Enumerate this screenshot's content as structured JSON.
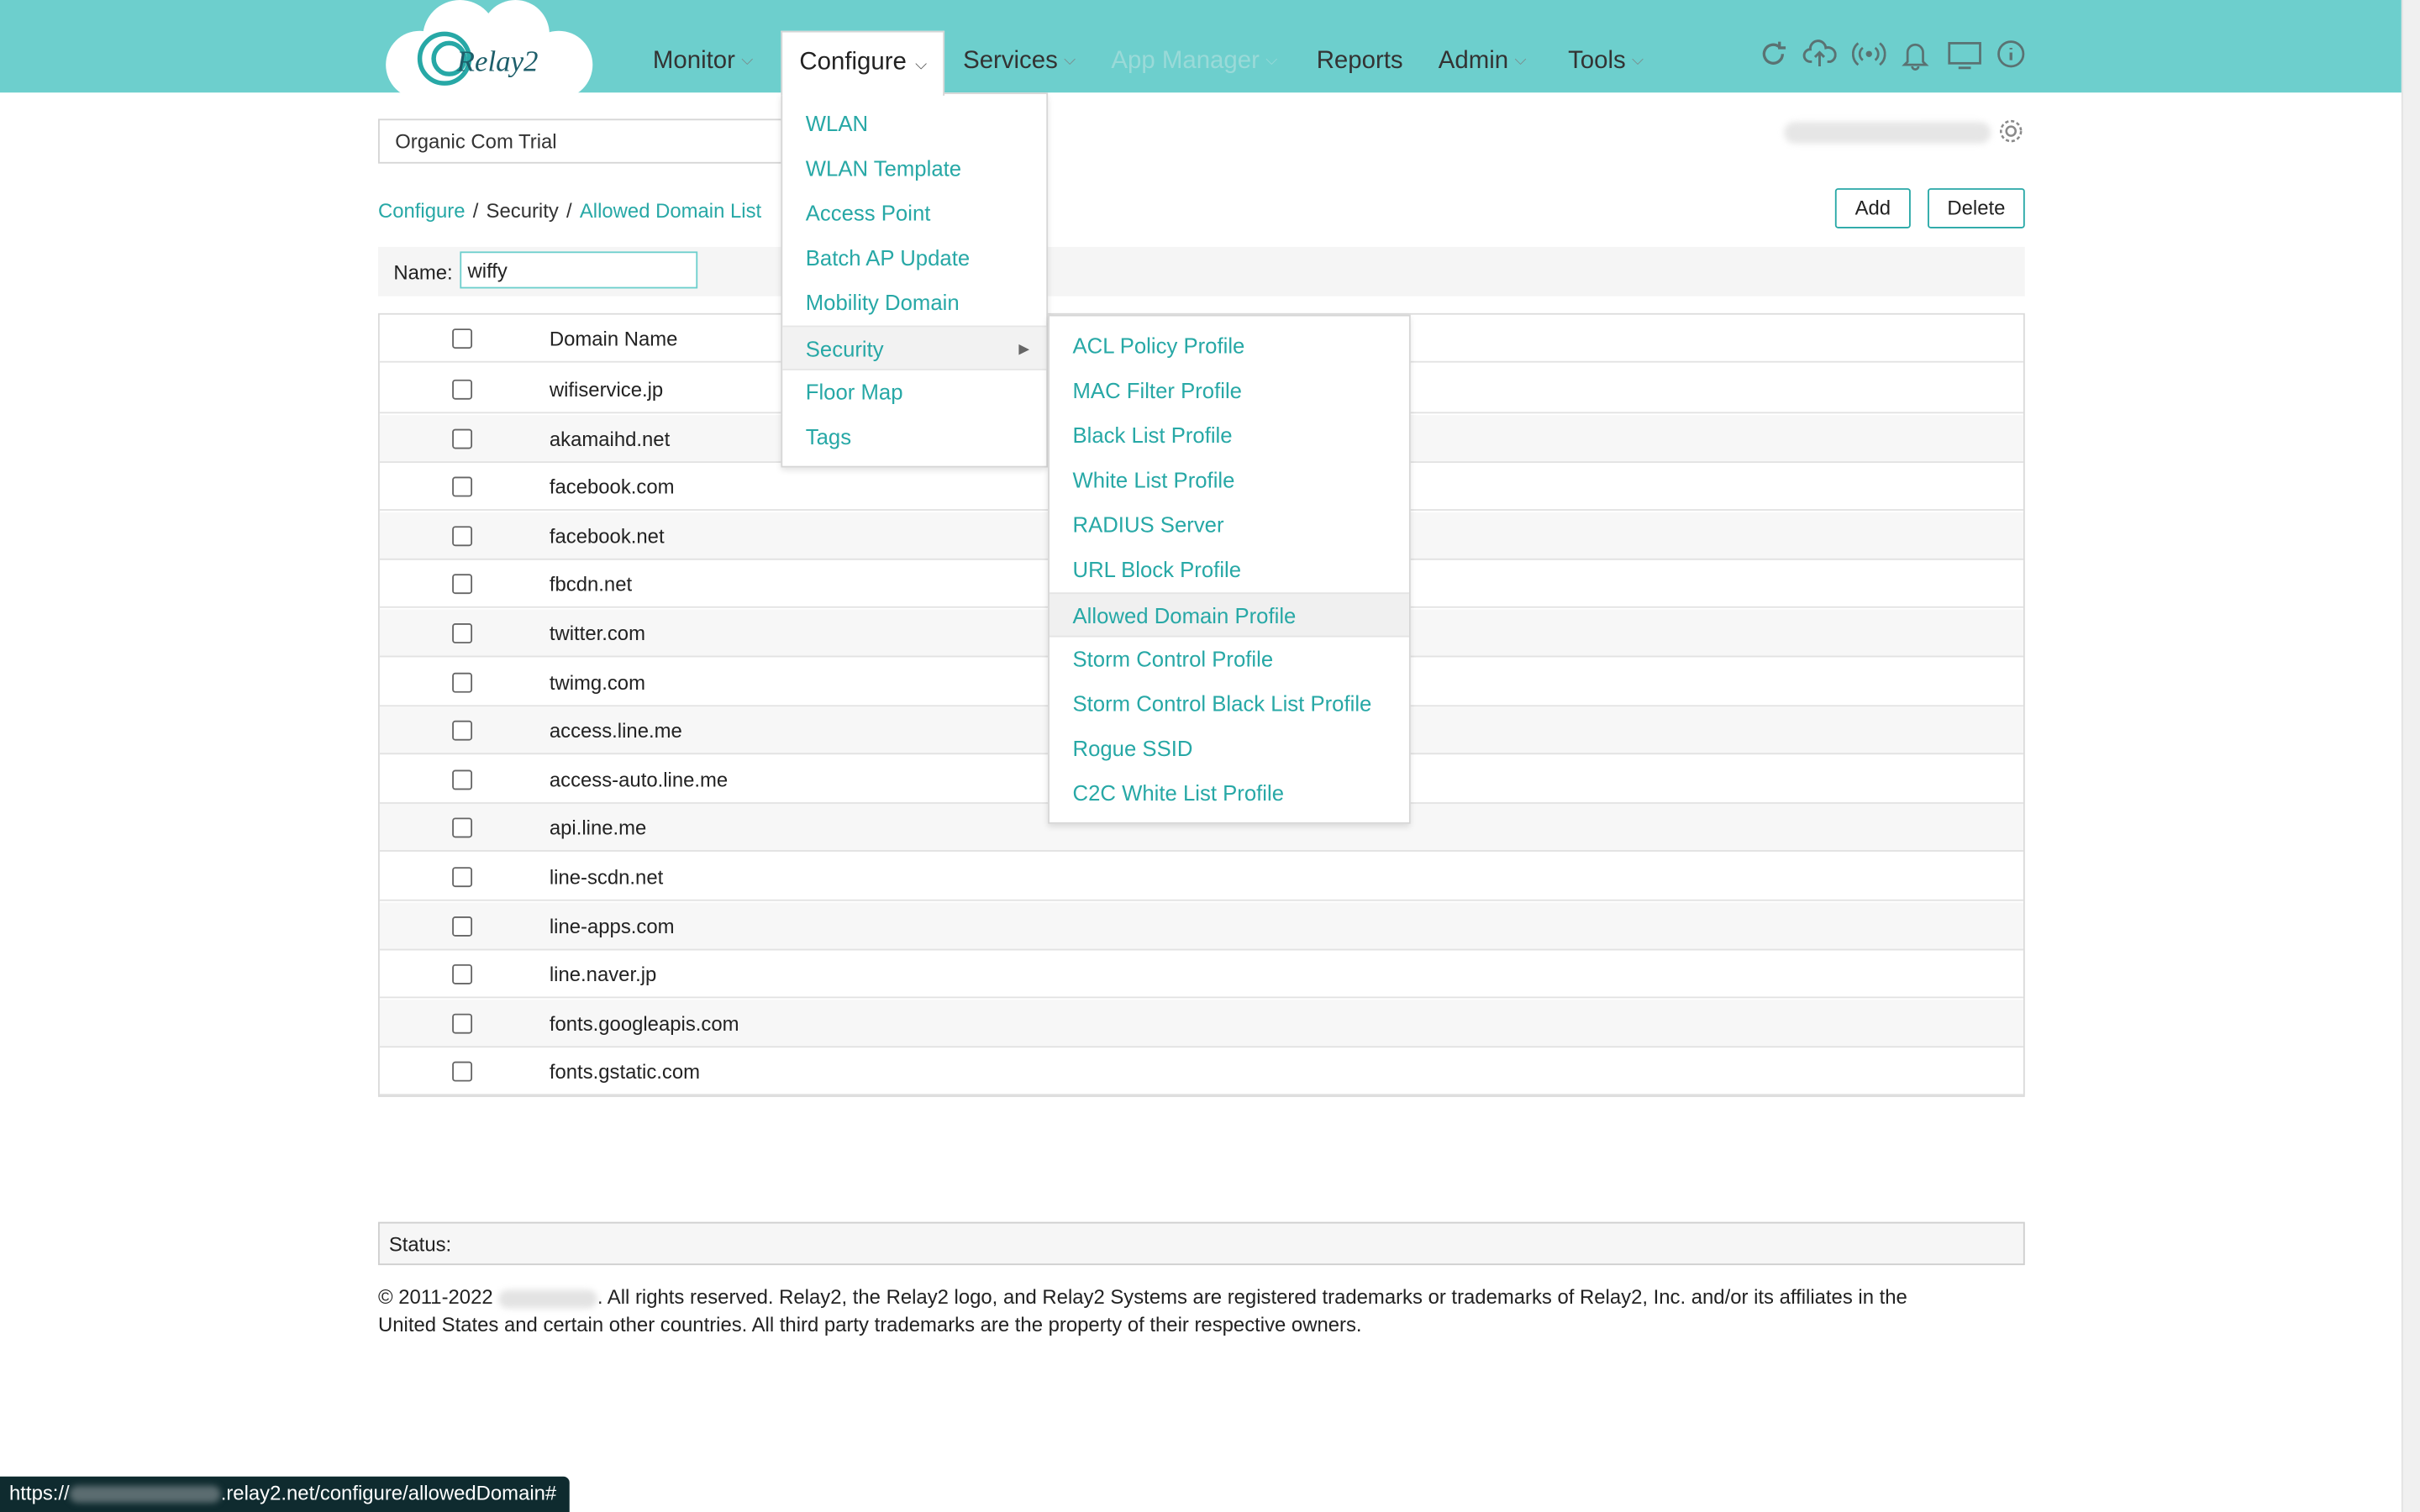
{
  "brand": {
    "logo_text": "Relay2",
    "accent": "#27a8a6",
    "header_bg": "#6dcfcd"
  },
  "nav": {
    "monitor": "Monitor",
    "configure": "Configure",
    "services": "Services",
    "app_manager": "App Manager",
    "reports": "Reports",
    "admin": "Admin",
    "tools": "Tools"
  },
  "top_icons": [
    "refresh-icon",
    "cloud-upload-icon",
    "broadcast-icon",
    "bell-icon",
    "monitor-icon",
    "info-icon"
  ],
  "org_selector": {
    "value": "Organic Com Trial"
  },
  "breadcrumb": {
    "part1": "Configure",
    "sep": "/",
    "part2": "Security",
    "part3": "Allowed Domain List"
  },
  "buttons": {
    "add": "Add",
    "delete": "Delete"
  },
  "name_filter": {
    "label": "Name:",
    "value": "wiffy"
  },
  "table": {
    "header": "Domain Name",
    "rows": [
      "wifiservice.jp",
      "akamaihd.net",
      "facebook.com",
      "facebook.net",
      "fbcdn.net",
      "twitter.com",
      "twimg.com",
      "access.line.me",
      "access-auto.line.me",
      "api.line.me",
      "line-scdn.net",
      "line-apps.com",
      "line.naver.jp",
      "fonts.googleapis.com",
      "fonts.gstatic.com"
    ]
  },
  "configure_menu": {
    "items": [
      "WLAN",
      "WLAN Template",
      "Access Point",
      "Batch AP Update",
      "Mobility Domain",
      "Security",
      "Floor Map",
      "Tags"
    ],
    "active": "Security"
  },
  "security_submenu": {
    "items": [
      "ACL Policy Profile",
      "MAC Filter Profile",
      "Black List Profile",
      "White List Profile",
      "RADIUS Server",
      "URL Block Profile",
      "Allowed Domain Profile",
      "Storm Control Profile",
      "Storm Control Black List Profile",
      "Rogue SSID",
      "C2C White List Profile"
    ],
    "highlighted": "Allowed Domain Profile"
  },
  "status": {
    "label": "Status:"
  },
  "footer": {
    "copyright_prefix": "© 2011-2022",
    "text_line1": ". All rights reserved. Relay2, the Relay2 logo, and Relay2 Systems are registered trademarks or trademarks of Relay2, Inc. and/or its affiliates in the",
    "text_line2": "United States and certain other countries. All third party trademarks are the property of their respective owners."
  },
  "status_url": {
    "prefix": "https://",
    "suffix": ".relay2.net/configure/allowedDomain#"
  }
}
